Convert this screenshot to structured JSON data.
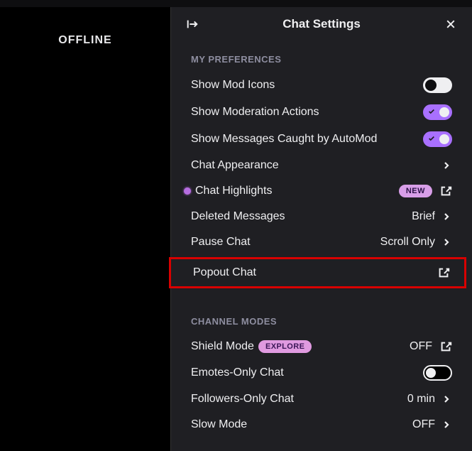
{
  "left": {
    "status": "OFFLINE"
  },
  "panel": {
    "title": "Chat Settings",
    "section_prefs": "MY PREFERENCES",
    "section_modes": "CHANNEL MODES",
    "rows": {
      "mod_icons": "Show Mod Icons",
      "mod_actions": "Show Moderation Actions",
      "automod": "Show Messages Caught by AutoMod",
      "appearance": "Chat Appearance",
      "highlights": "Chat Highlights",
      "highlights_badge": "NEW",
      "deleted": "Deleted Messages",
      "deleted_val": "Brief",
      "pause": "Pause Chat",
      "pause_val": "Scroll Only",
      "popout": "Popout Chat",
      "shield": "Shield Mode",
      "shield_badge": "EXPLORE",
      "shield_val": "OFF",
      "emotes": "Emotes-Only Chat",
      "followers": "Followers-Only Chat",
      "followers_val": "0 min",
      "slow": "Slow Mode",
      "slow_val": "OFF"
    }
  }
}
